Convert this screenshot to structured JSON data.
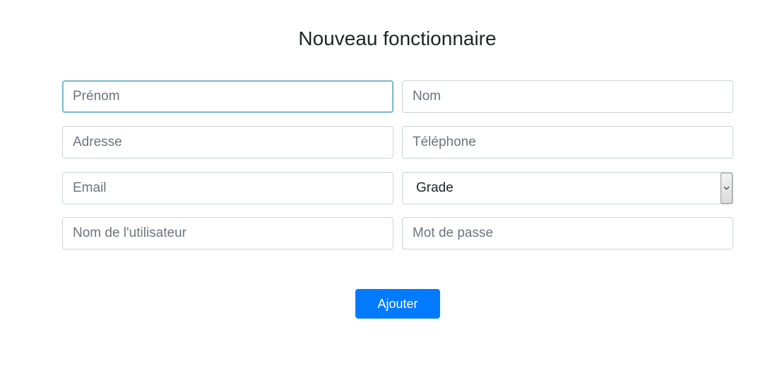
{
  "form": {
    "title": "Nouveau fonctionnaire",
    "fields": {
      "prenom": {
        "placeholder": "Prénom"
      },
      "nom": {
        "placeholder": "Nom"
      },
      "adresse": {
        "placeholder": "Adresse"
      },
      "telephone": {
        "placeholder": "Téléphone"
      },
      "email": {
        "placeholder": "Email"
      },
      "grade": {
        "selected": "Grade"
      },
      "username": {
        "placeholder": "Nom de l'utilisateur"
      },
      "password": {
        "placeholder": "Mot de passe"
      }
    },
    "submit_label": "Ajouter"
  },
  "colors": {
    "primary_button": "#007bff",
    "focus_border": "#80bdcf",
    "input_border": "#ced4da",
    "text": "#212529"
  }
}
